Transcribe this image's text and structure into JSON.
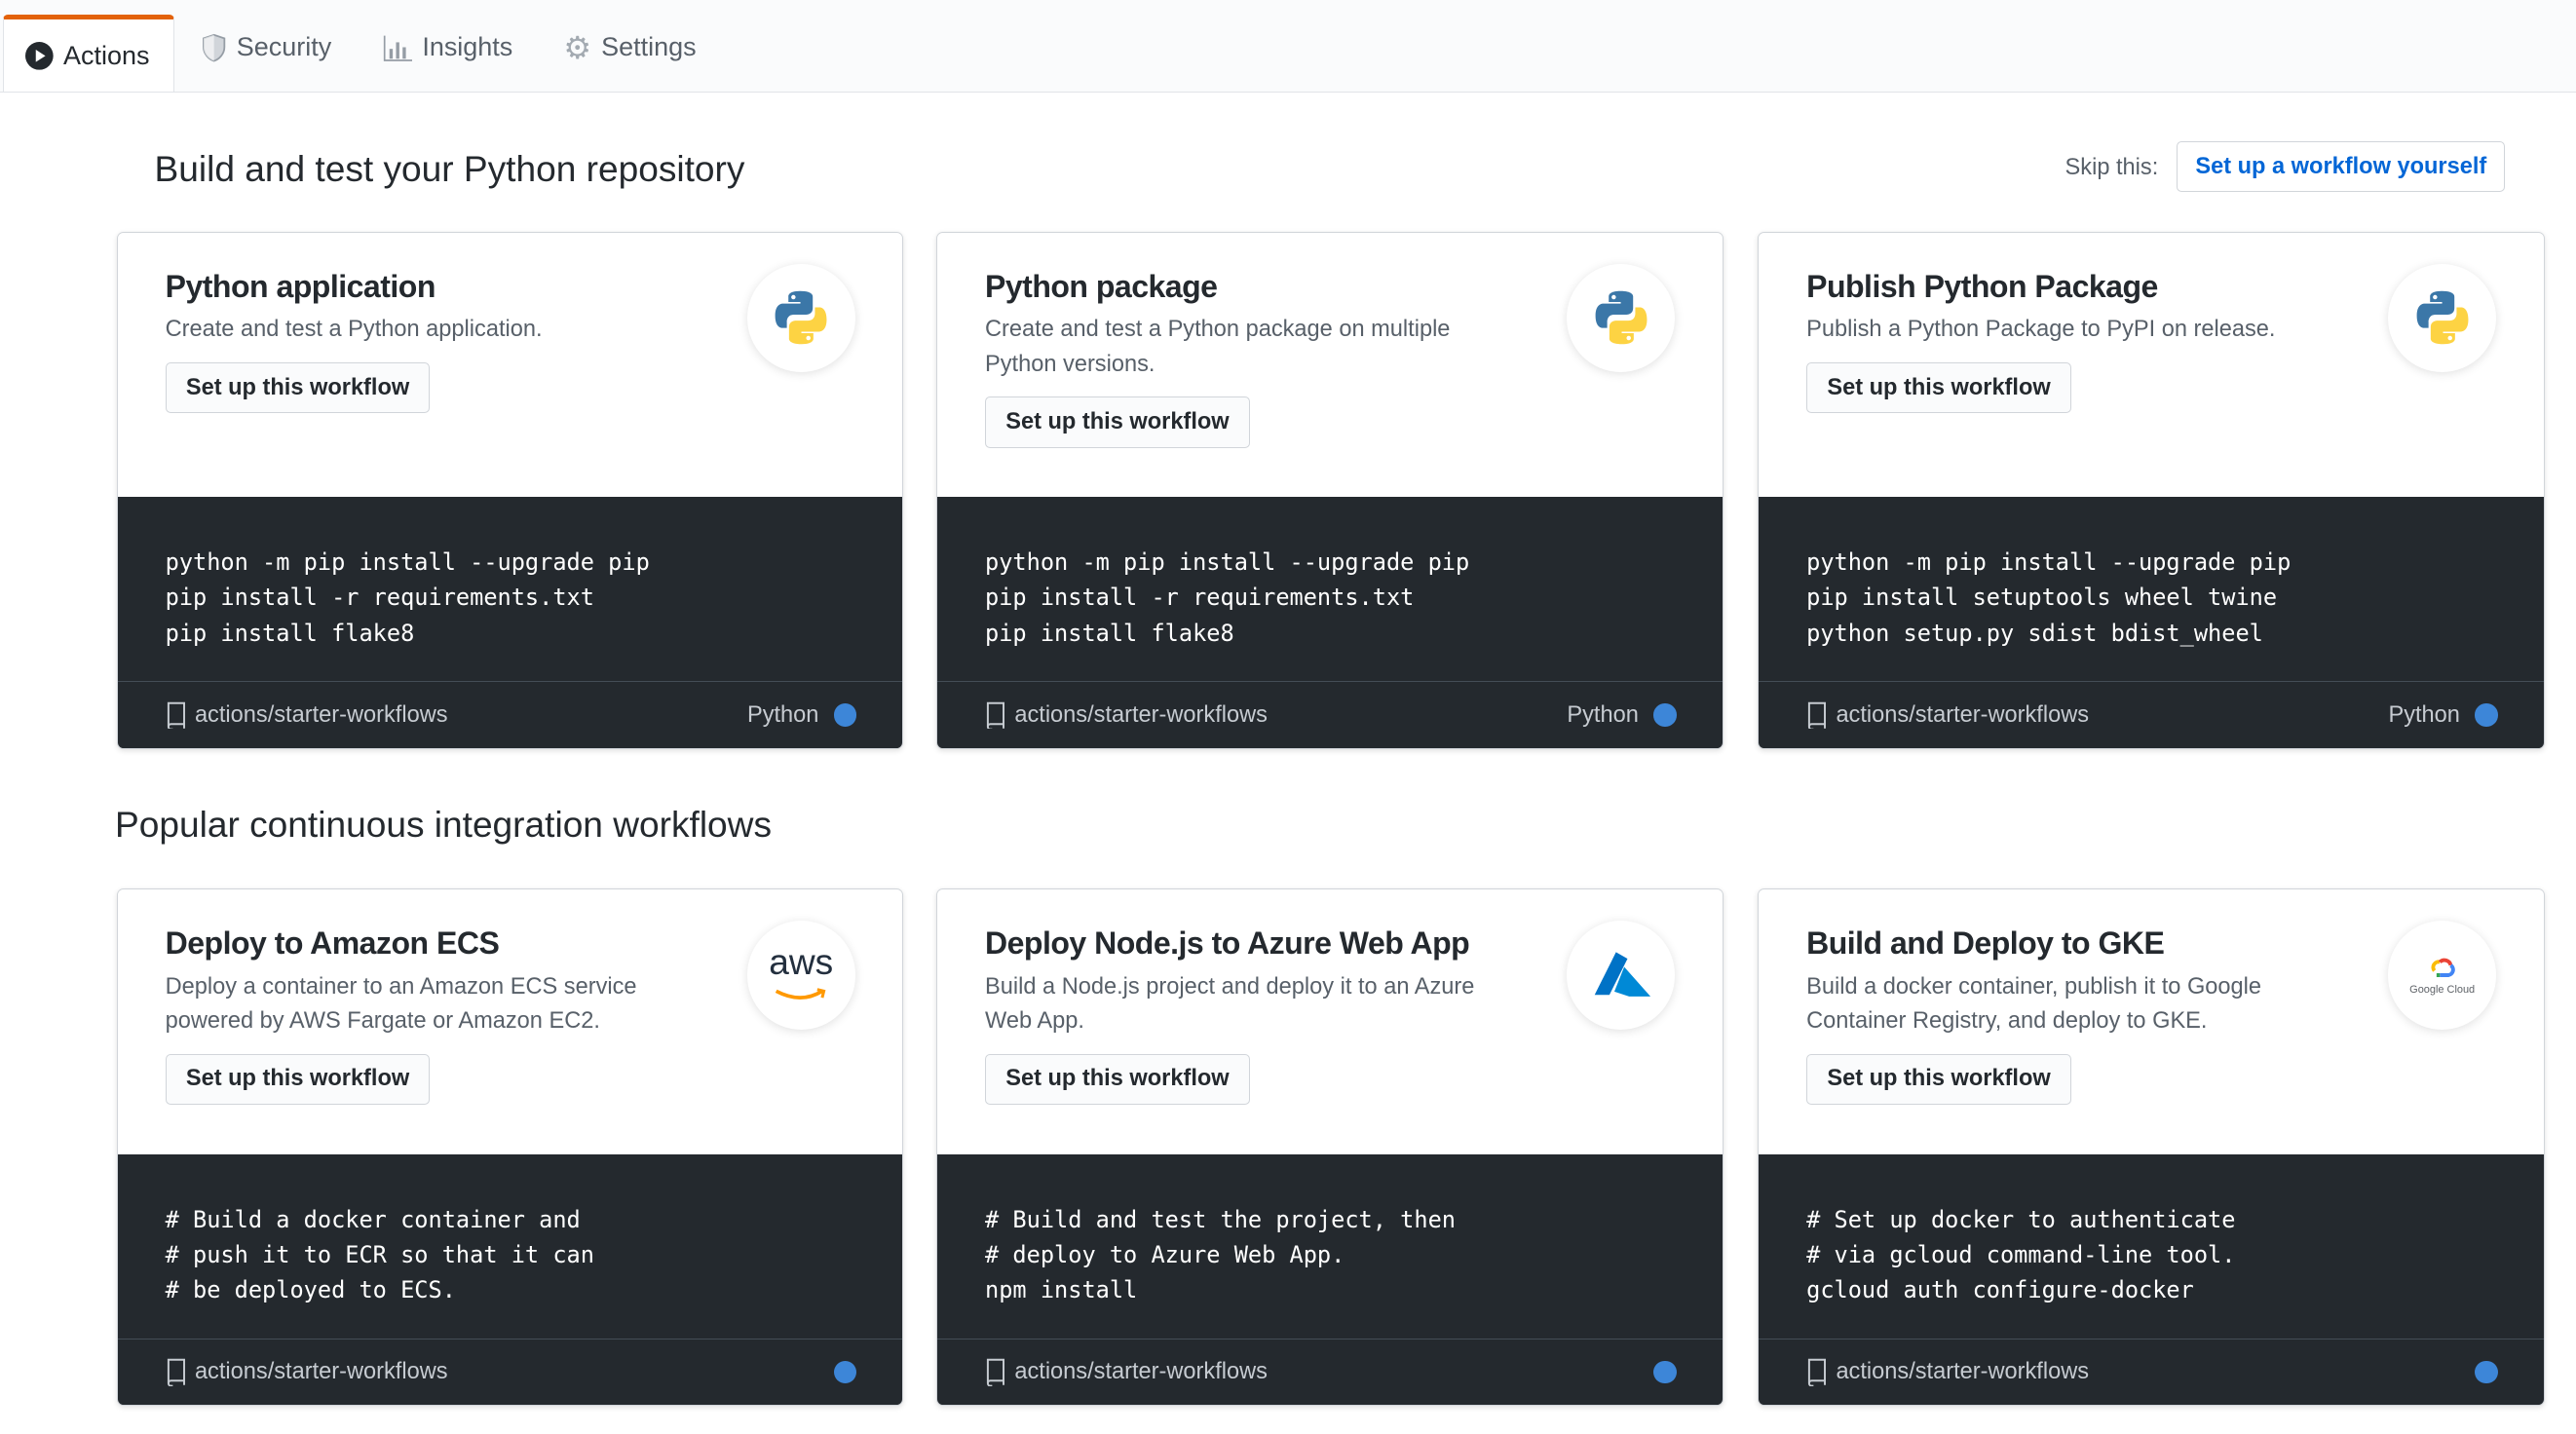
{
  "tabs": [
    {
      "label": "Actions",
      "icon": "play-icon"
    },
    {
      "label": "Security",
      "icon": "shield-icon"
    },
    {
      "label": "Insights",
      "icon": "graph-icon"
    },
    {
      "label": "Settings",
      "icon": "gear-icon"
    }
  ],
  "section1": {
    "title": "Build and test your Python repository",
    "skip_label": "Skip this:",
    "skip_button": "Set up a workflow yourself"
  },
  "section2": {
    "title": "Popular continuous integration workflows"
  },
  "button_label": "Set up this workflow",
  "colors": {
    "accent": "#e36209",
    "link": "#0366d6",
    "code_bg": "#24292e",
    "lang_dot": "#3d86d8"
  },
  "cards": [
    {
      "title": "Python application",
      "desc": "Create and test a Python application.",
      "code": "python -m pip install --upgrade pip\npip install -r requirements.txt\npip install flake8",
      "repo": "actions/starter-workflows",
      "lang": "Python",
      "logo": "python"
    },
    {
      "title": "Python package",
      "desc": "Create and test a Python package on multiple Python versions.",
      "code": "python -m pip install --upgrade pip\npip install -r requirements.txt\npip install flake8",
      "repo": "actions/starter-workflows",
      "lang": "Python",
      "logo": "python"
    },
    {
      "title": "Publish Python Package",
      "desc": "Publish a Python Package to PyPI on release.",
      "code": "python -m pip install --upgrade pip\npip install setuptools wheel twine\npython setup.py sdist bdist_wheel",
      "repo": "actions/starter-workflows",
      "lang": "Python",
      "logo": "python"
    },
    {
      "title": "Deploy to Amazon ECS",
      "desc": "Deploy a container to an Amazon ECS service powered by AWS Fargate or Amazon EC2.",
      "code": "# Build a docker container and\n# push it to ECR so that it can\n# be deployed to ECS.",
      "repo": "actions/starter-workflows",
      "lang": "",
      "logo": "aws",
      "logo_text": "aws"
    },
    {
      "title": "Deploy Node.js to Azure Web App",
      "desc": "Build a Node.js project and deploy it to an Azure Web App.",
      "code": "# Build and test the project, then\n# deploy to Azure Web App.\nnpm install",
      "repo": "actions/starter-workflows",
      "lang": "",
      "logo": "azure"
    },
    {
      "title": "Build and Deploy to GKE",
      "desc": "Build a docker container, publish it to Google Container Registry, and deploy to GKE.",
      "code": "# Set up docker to authenticate\n# via gcloud command-line tool.\ngcloud auth configure-docker",
      "repo": "actions/starter-workflows",
      "lang": "",
      "logo": "google-cloud",
      "logo_text": "Google Cloud"
    }
  ]
}
